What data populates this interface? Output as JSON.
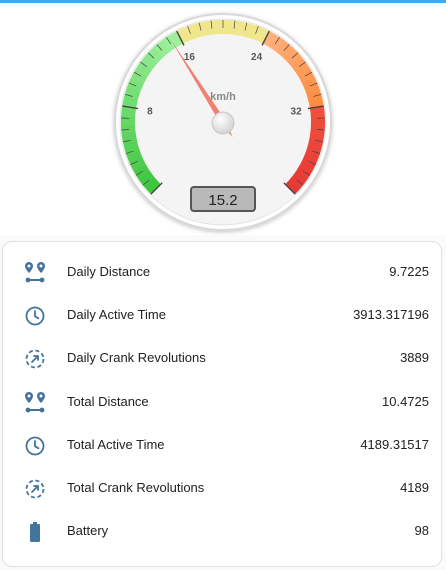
{
  "gauge": {
    "unit": "km/h",
    "value": 15.2,
    "value_text": "15.2",
    "min": 0,
    "max": 40,
    "tick_labels": [
      "8",
      "16",
      "24",
      "32"
    ],
    "colors": {
      "green": "#3ec63e",
      "yellow": "#f0e68c",
      "orange": "#ff8c42",
      "red": "#e53935",
      "needle": "#f08070"
    }
  },
  "entities": [
    {
      "icon": "map-marker-distance-icon",
      "name": "Daily Distance",
      "value": "9.7225"
    },
    {
      "icon": "clock-outline-icon",
      "name": "Daily Active Time",
      "value": "3913.317196"
    },
    {
      "icon": "rotate-dashed-icon",
      "name": "Daily Crank Revolutions",
      "value": "3889"
    },
    {
      "icon": "map-marker-distance-icon",
      "name": "Total Distance",
      "value": "10.4725"
    },
    {
      "icon": "clock-outline-icon",
      "name": "Total Active Time",
      "value": "4189.31517"
    },
    {
      "icon": "rotate-dashed-icon",
      "name": "Total Crank Revolutions",
      "value": "4189"
    },
    {
      "icon": "battery-icon",
      "name": "Battery",
      "value": "98"
    }
  ],
  "icon_color": "#44739e"
}
